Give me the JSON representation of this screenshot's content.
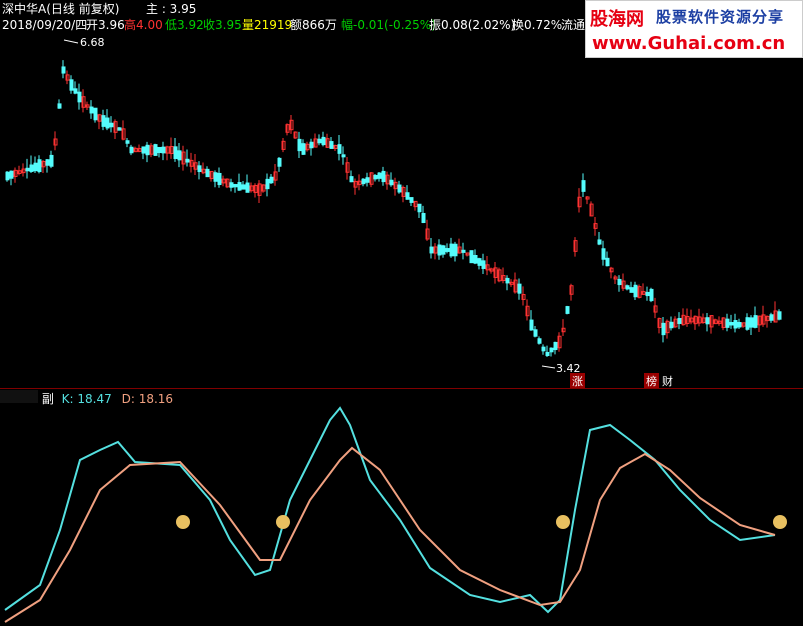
{
  "header": {
    "stock_name": "深中华A(日线 前复权)",
    "mid_label": "主 : 3.95",
    "date": "2018/09/20/四",
    "open_label": "开3.96",
    "high_label": "高4.00",
    "low_label": "低3.92",
    "close_label": "收3.95",
    "volume_label": "量21919",
    "amount_label": "额866万",
    "change_label": "幅-0.01(-0.25%)",
    "amplitude_label": "振0.08(2.02%)",
    "turnover_label": "换0.72%",
    "float_label": "流通"
  },
  "watermark": {
    "brand": "股海网",
    "tagline": "股票软件资源分享",
    "url": "www.Guhai.com.cn"
  },
  "main_chart": {
    "high_marker": "6.68",
    "low_marker": "3.42",
    "badge_zhang": "涨",
    "badge_bang": "榜",
    "badge_cai": "财"
  },
  "sub_chart": {
    "title": "副",
    "k_label": "K: 18.47",
    "d_label": "D: 18.16"
  },
  "colors": {
    "background": "#000000",
    "up": "#ff3232",
    "down": "#54fcfc",
    "k_line": "#54e0e0",
    "d_line": "#f0a080",
    "divider": "#800000",
    "signal": "#e8c060"
  },
  "chart_data": {
    "type": "candlestick",
    "price_max": 6.68,
    "price_min": 3.42,
    "last_close": 3.95,
    "k_last": 18.47,
    "d_last": 18.16
  }
}
